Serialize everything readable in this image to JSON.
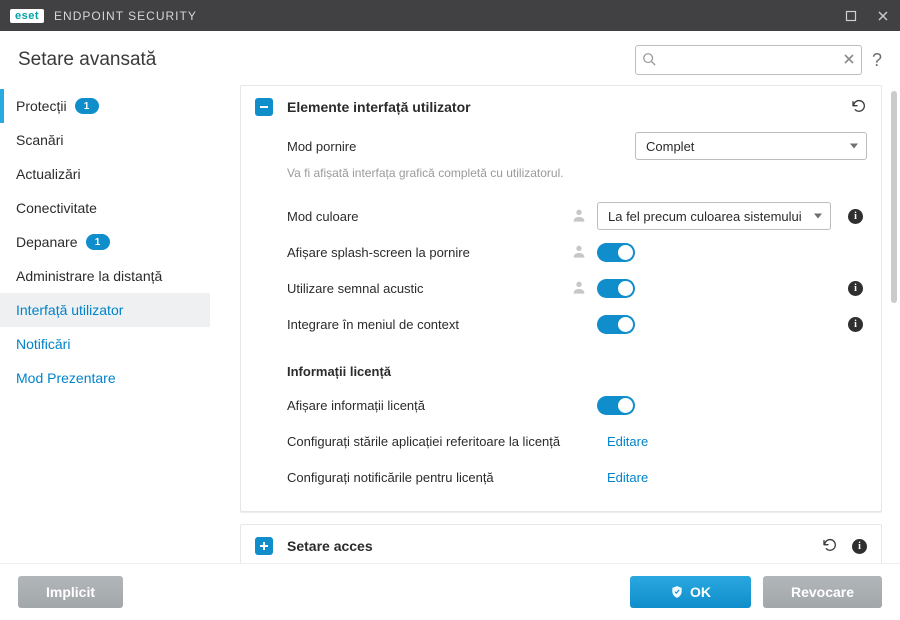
{
  "brand": {
    "logo_text": "eset",
    "product": "ENDPOINT SECURITY"
  },
  "page_title": "Setare avansată",
  "search": {
    "value": "",
    "placeholder": ""
  },
  "sidebar": {
    "items": [
      {
        "label": "Protecții",
        "badge": "1"
      },
      {
        "label": "Scanări"
      },
      {
        "label": "Actualizări"
      },
      {
        "label": "Conectivitate"
      },
      {
        "label": "Depanare",
        "badge": "1"
      },
      {
        "label": "Administrare la distanță"
      },
      {
        "label": "Interfață utilizator"
      },
      {
        "label": "Notificări"
      },
      {
        "label": "Mod Prezentare"
      }
    ]
  },
  "panel_ui": {
    "title": "Elemente interfață utilizator",
    "rows": {
      "start_mode": {
        "label": "Mod pornire",
        "value": "Complet",
        "hint": "Va fi afișată interfața grafică completă cu utilizatorul."
      },
      "color_mode": {
        "label": "Mod culoare",
        "value": "La fel precum culoarea sistemului"
      },
      "splash": {
        "label": "Afișare splash-screen la pornire"
      },
      "sound": {
        "label": "Utilizare semnal acustic"
      },
      "context": {
        "label": "Integrare în meniul de context"
      }
    },
    "license": {
      "heading": "Informații licență",
      "show": {
        "label": "Afișare informații licență"
      },
      "states": {
        "label": "Configurați stările aplicației referitoare la licență",
        "action": "Editare"
      },
      "notif": {
        "label": "Configurați notificările pentru licență",
        "action": "Editare"
      }
    }
  },
  "panel_access": {
    "title": "Setare acces"
  },
  "footer": {
    "default": "Implicit",
    "ok": "OK",
    "cancel": "Revocare"
  }
}
